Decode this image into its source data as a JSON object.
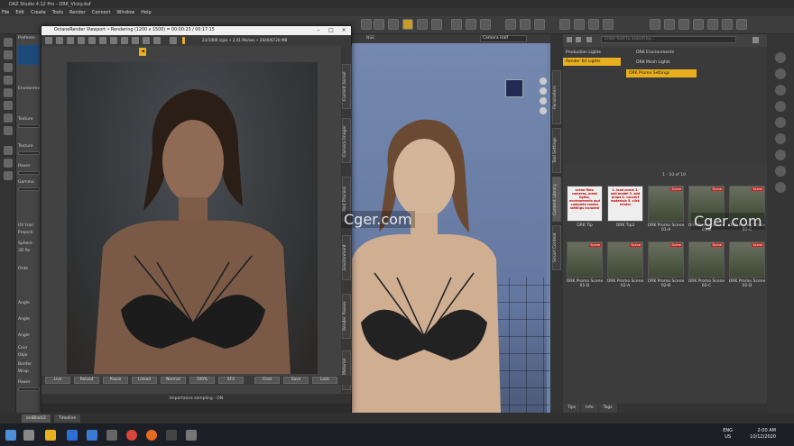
{
  "app": {
    "title": "DAZ Studio 4.12 Pro - ORK_Vicky.duf"
  },
  "menu": [
    "File",
    "Edit",
    "Create",
    "Tools",
    "Render",
    "Connect",
    "Window",
    "Help"
  ],
  "left_pane": {
    "tab": "Preferen",
    "labels": [
      "Environme",
      "Texture",
      "Texture",
      "Power",
      "Gamma",
      "UV tran",
      "Projecti",
      "Sphere",
      "3D Re",
      "Orde",
      "Angle",
      "Angle",
      "Angle",
      "Coor",
      "Obje",
      "Border",
      "Wrap",
      "Power"
    ]
  },
  "octane": {
    "title": "OctaneRender Viewport • Rendering (1200 x 1500) = 00:00:23 / 00:17:15",
    "stats": "23/1000 s/pix • 2.01 Ms/sec • 2640/6720 MB",
    "marker": "◄",
    "side_tabs": [
      "Current Kernel",
      "Camera Imager",
      "Post Process",
      "Environment",
      "Render Passes",
      "Set Material"
    ],
    "bottom_buttons": [
      "Live",
      "Reload",
      "Pause",
      "Linked",
      "Normal",
      "100%",
      "SFX",
      "Final",
      "Save",
      "Lock"
    ],
    "status": "Importance sampling - ON"
  },
  "viewport": {
    "camera": "Camera Half",
    "top_label": "NSE"
  },
  "right_vtabs": [
    "Parameters",
    "Tool Settings",
    "Content Library",
    "Smart Content"
  ],
  "content_library": {
    "search_placeholder": "Enter text to search by...",
    "tree": {
      "item1": "Production Lights",
      "item2": "Render Kit Lights",
      "item3": "ORK Environments",
      "item4": "ORK Mesh Lights",
      "item5": "ORK Promo Settings"
    },
    "count": "1 - 10 of 10",
    "thumbnails": [
      {
        "label": "ORK Tip",
        "badge": "",
        "note": "scene files: cameras, mesh lights, environments and complete render settings included"
      },
      {
        "label": "ORK Tip2",
        "badge": "",
        "note": "1. load scene 2. add model 3. add props 4. convert materials 5. click render"
      },
      {
        "label": "ORK Promo Scene 01-A",
        "badge": "Scene",
        "note": ""
      },
      {
        "label": "ORK Promo Scene 01-B",
        "badge": "Scene",
        "note": ""
      },
      {
        "label": "ORK Promo Scene 01-C",
        "badge": "Scene",
        "note": ""
      },
      {
        "label": "ORK Promo Scene 01-D",
        "badge": "Scene",
        "note": ""
      },
      {
        "label": "ORK Promo Scene 02-A",
        "badge": "Scene",
        "note": ""
      },
      {
        "label": "ORK Promo Scene 02-B",
        "badge": "Scene",
        "note": ""
      },
      {
        "label": "ORK Promo Scene 02-C",
        "badge": "Scene",
        "note": ""
      },
      {
        "label": "ORK Promo Scene 02-D",
        "badge": "Scene",
        "note": ""
      }
    ],
    "bottom_tabs": [
      "Tips",
      "Info",
      "Tags"
    ]
  },
  "bottom_tabs": [
    "aniBlock2",
    "Timeline"
  ],
  "taskbar": {
    "lang": "ENG",
    "region": "US",
    "time": "2:00 AM",
    "date": "10/12/2020"
  },
  "watermark": "Cger.com",
  "colors": {
    "accent": "#e8b020",
    "badge": "#c52020",
    "viewport_bg": "#6d82a6"
  }
}
